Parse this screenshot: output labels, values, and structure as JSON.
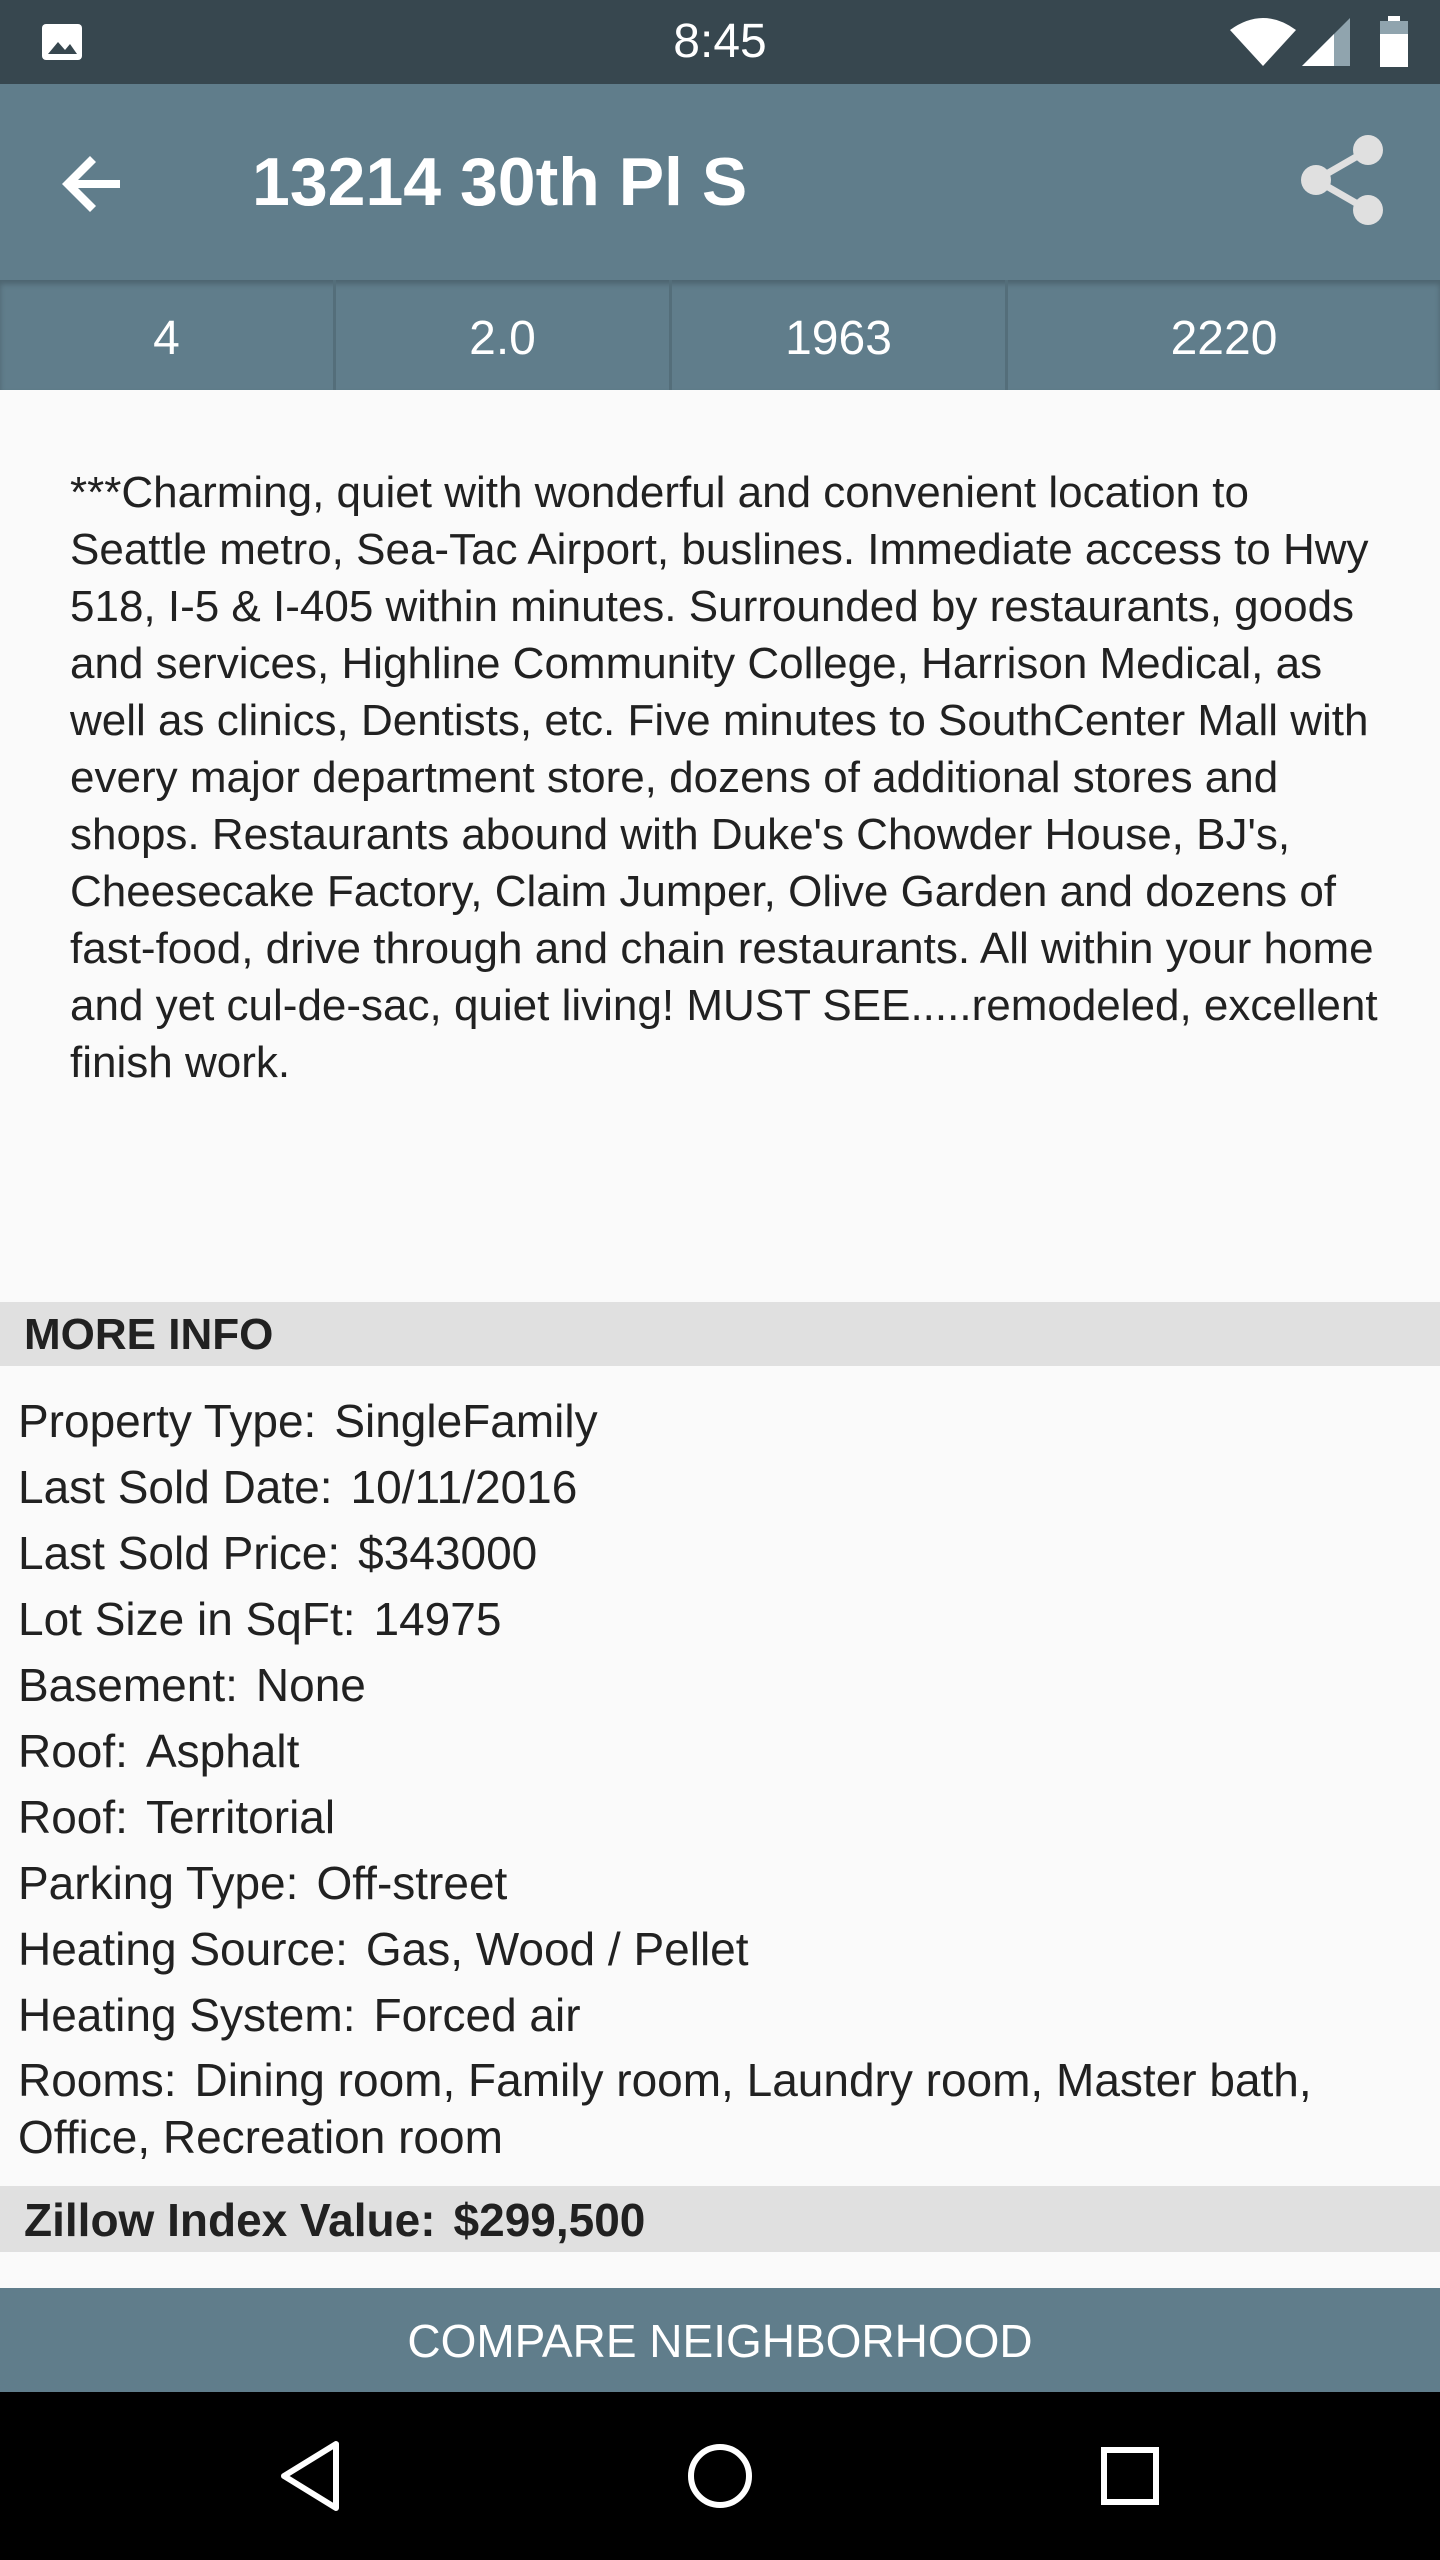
{
  "status_bar": {
    "time": "8:45",
    "icons": [
      "gallery-icon",
      "wifi-icon",
      "signal-icon",
      "battery-icon"
    ]
  },
  "app_bar": {
    "title": "13214 30th Pl S",
    "icons": [
      "back-arrow-icon",
      "share-icon"
    ]
  },
  "stats": [
    "4",
    "2.0",
    "1963",
    "2220"
  ],
  "description": "***Charming, quiet with wonderful and convenient  location to Seattle metro, Sea-Tac Airport, buslines.  Immediate access to Hwy 518, I-5 & I-405 within minutes. Surrounded by restaurants, goods and services, Highline Community College, Harrison Medical, as well as clinics, Dentists, etc. Five minutes to SouthCenter Mall with every major department store, dozens of additional stores and shops. Restaurants abound with Duke's Chowder House, BJ's, Cheesecake Factory, Claim Jumper, Olive Garden and dozens of fast-food, drive through and chain restaurants. All within your home and yet cul-de-sac, quiet living!  MUST SEE.....remodeled, excellent finish work.",
  "more_info": {
    "header": "MORE INFO",
    "items": [
      {
        "label": "Property Type:",
        "value": "SingleFamily"
      },
      {
        "label": "Last Sold Date:",
        "value": "10/11/2016"
      },
      {
        "label": "Last Sold Price:",
        "value": "$343000"
      },
      {
        "label": "Lot Size in SqFt:",
        "value": "14975"
      },
      {
        "label": "Basement:",
        "value": "None"
      },
      {
        "label": "Roof:",
        "value": "Asphalt"
      },
      {
        "label": "Roof:",
        "value": "Territorial"
      },
      {
        "label": "Parking Type:",
        "value": "Off-street"
      },
      {
        "label": "Heating Source:",
        "value": "Gas, Wood / Pellet"
      },
      {
        "label": "Heating System:",
        "value": "Forced air"
      },
      {
        "label": "Rooms:",
        "value": "Dining room, Family room, Laundry room, Master bath, Office, Recreation room"
      }
    ]
  },
  "zillow": {
    "label": "Zillow Index Value:",
    "value": "$299,500"
  },
  "compare_button": "COMPARE NEIGHBORHOOD",
  "nav_bar": {
    "icons": [
      "nav-back-icon",
      "nav-home-icon",
      "nav-recent-apps-icon"
    ]
  },
  "colors": {
    "status_bar": "#37474f",
    "primary": "#607d8b",
    "section_bg": "#e0e0e0",
    "page_bg": "#fafafa"
  }
}
